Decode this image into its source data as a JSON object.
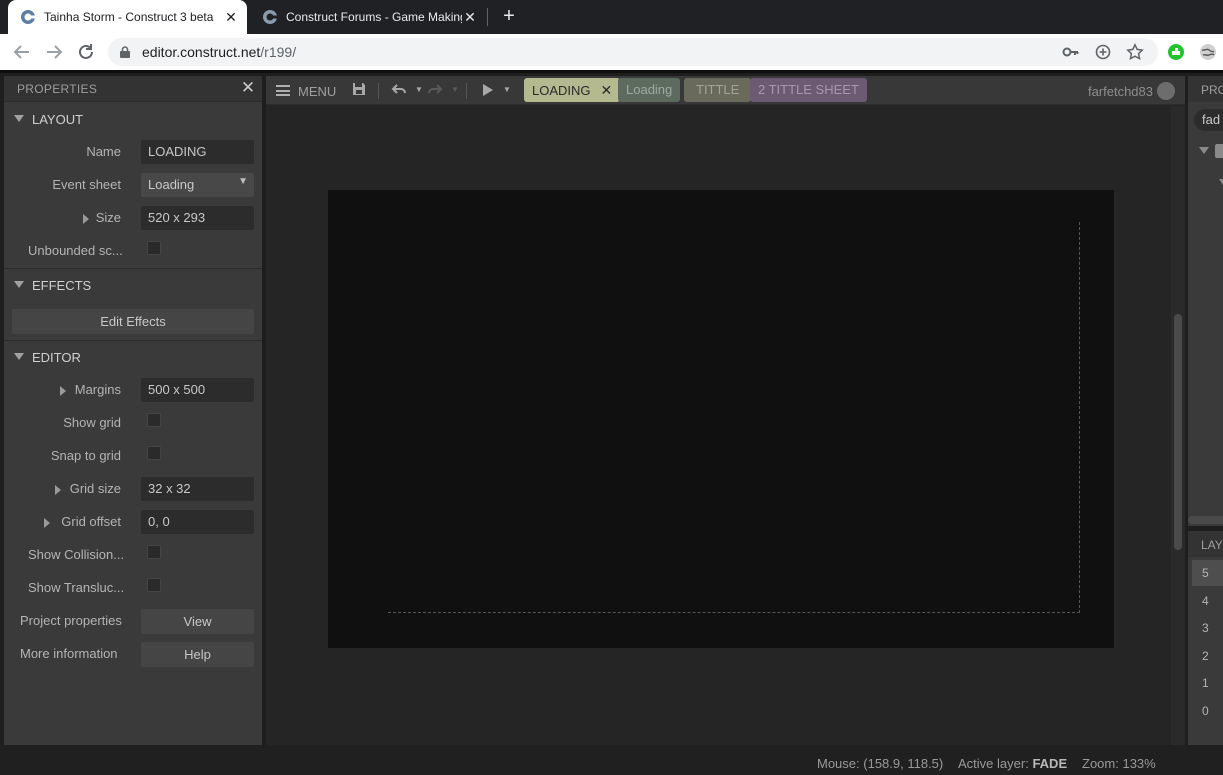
{
  "browser": {
    "tabs": [
      {
        "title": "Tainha Storm - Construct 3 beta",
        "close": "✕"
      },
      {
        "title": "Construct Forums - Game Making",
        "close": "✕"
      }
    ],
    "new_tab": "+",
    "url_host": "editor.construct.net",
    "url_path": "/r199/"
  },
  "properties": {
    "title": "PROPERTIES",
    "close": "✕",
    "sections": {
      "layout": "LAYOUT",
      "effects": "EFFECTS",
      "editor": "EDITOR"
    },
    "layout": {
      "name_label": "Name",
      "name_value": "LOADING",
      "eventsheet_label": "Event sheet",
      "eventsheet_value": "Loading",
      "size_label": "Size",
      "size_value": "520 x 293",
      "unbounded_label": "Unbounded sc..."
    },
    "effects": {
      "edit_label": "Edit Effects"
    },
    "editor": {
      "margins_label": "Margins",
      "margins_value": "500 x 500",
      "showgrid_label": "Show grid",
      "snap_label": "Snap to grid",
      "gridsize_label": "Grid size",
      "gridsize_value": "32 x 32",
      "gridoffset_label": "Grid offset",
      "gridoffset_value": "0, 0",
      "collision_label": "Show Collision...",
      "translucent_label": "Show Transluc...",
      "projprops_label": "Project properties",
      "projprops_btn": "View",
      "moreinfo_label": "More information",
      "moreinfo_btn": "Help"
    }
  },
  "editor": {
    "menu_label": "MENU",
    "tabs": [
      {
        "label": "LOADING",
        "close": "✕"
      },
      {
        "label": "Loading"
      },
      {
        "label": "TITTLE"
      },
      {
        "label": "2 TITTLE SHEET"
      }
    ],
    "username": "farfetchd83",
    "status": {
      "mouse_label": "Mouse:",
      "mouse_value": "(158.9, 118.5)",
      "layer_label": "Active layer:",
      "layer_value": "FADE",
      "zoom_label": "Zoom:",
      "zoom_value": "133%"
    }
  },
  "project_panel": {
    "title": "PRO",
    "search_value": "fad"
  },
  "layers_panel": {
    "title": "LAY",
    "items": [
      "5",
      "4",
      "3",
      "2",
      "1",
      "0"
    ]
  },
  "colors": {
    "tab_loading": "#b5b990",
    "tab_loading_sheet": "#5d6b5e",
    "tab_tittle": "#6a6a5c",
    "tab_tittle_sheet": "#6b5a72"
  }
}
